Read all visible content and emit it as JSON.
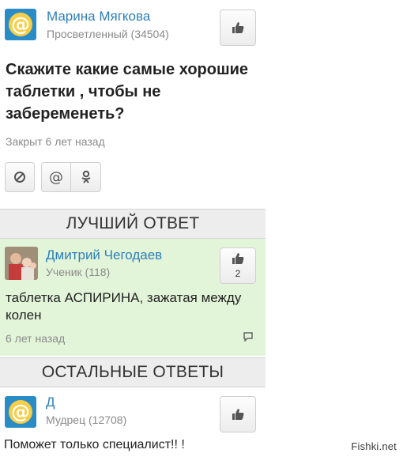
{
  "question_author": {
    "name": "Марина Мягкова",
    "rank": "Просветленный (34504)",
    "avatar_icon": "mail-at-icon"
  },
  "question": {
    "text": "Скажите какие самые хорошие таблетки , чтобы не забеременеть?",
    "status": "Закрыт 6 лет назад"
  },
  "share": {
    "buttons": [
      "block-icon",
      "mail-at-icon",
      "odnoklassniki-icon"
    ]
  },
  "sections": {
    "best_answer": "ЛУЧШИЙ ОТВЕТ",
    "other_answers": "ОСТАЛЬНЫЕ ОТВЕТЫ"
  },
  "best_answer": {
    "author_name": "Дмитрий Чегодаев",
    "author_rank": "Ученик (118)",
    "likes": "2",
    "text": "таблетка АСПИРИНА, зажатая между колен",
    "time": "6 лет назад"
  },
  "other_answer": {
    "author_name": "Д",
    "author_rank": "Мудрец (12708)",
    "text": "Поможет только специалист!! !"
  },
  "watermark": "Fishki.net",
  "colors": {
    "link_blue": "#2d7fb9",
    "best_answer_bg": "#e3f5d9",
    "section_bar_bg": "#ededed",
    "mail_avatar_bg": "#2a8cc6",
    "mail_avatar_ring": "#f7ce46"
  }
}
